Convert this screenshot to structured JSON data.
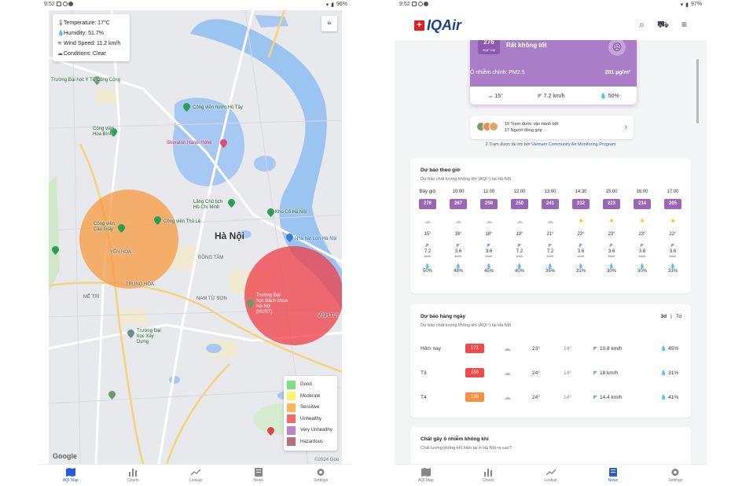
{
  "left": {
    "status": {
      "time": "9:52",
      "battery": "96%"
    },
    "weather": {
      "temperature": "Temperature: 17°C",
      "humidity": "Humidity: 51.7%",
      "wind": "Wind Speed: 11.2 km/h",
      "conditions": "Conditions: Clear"
    },
    "map": {
      "city": "Hà Nội",
      "places": [
        {
          "name": "Trường Đại học Y Tế Công Cộng",
          "style": "green"
        },
        {
          "name": "Công viên nước Hồ Tây",
          "style": "green"
        },
        {
          "name": "Công viên Hòa Bình",
          "style": "green"
        },
        {
          "name": "Sheraton Hanoi Hotel",
          "style": "pink"
        },
        {
          "name": "Lăng Chủ tịch Hồ Chí Minh",
          "style": "green"
        },
        {
          "name": "Công viên Cầu Giấy",
          "style": "green"
        },
        {
          "name": "Công viên Thủ Lệ",
          "style": "green"
        },
        {
          "name": "Khu Cổ Hà Nội",
          "style": "green"
        },
        {
          "name": "Nhà hát Lớn Hà Nội",
          "style": "blue"
        },
        {
          "name": "YÊN HÒA",
          "style": "dark"
        },
        {
          "name": "TRUNG HÒA",
          "style": "dark"
        },
        {
          "name": "Trường Đại học Bách khoa Hà Nội (HUST)",
          "style": "green"
        },
        {
          "name": "Trường Đại học Xây Dựng",
          "style": "green"
        },
        {
          "name": "ĐỒNG TÂM",
          "style": "dark"
        },
        {
          "name": "MỄ TRÌ",
          "style": "dark"
        },
        {
          "name": "NAM TỪ SƠN",
          "style": "dark"
        },
        {
          "name": "VĨNH TUY",
          "style": "dark"
        }
      ],
      "copyright": "©2024 Goo",
      "google": "Google"
    },
    "legend": [
      {
        "label": "Good",
        "color": "#7ee07e"
      },
      {
        "label": "Moderate",
        "color": "#fff36b"
      },
      {
        "label": "Sensitive",
        "color": "#ffb45a"
      },
      {
        "label": "Unhealthy",
        "color": "#f26a6a"
      },
      {
        "label": "Very Unhealthy",
        "color": "#b984c9"
      },
      {
        "label": "Hazardous",
        "color": "#b8707c"
      }
    ],
    "nav": [
      {
        "label": "AQI Map",
        "icon": "map-icon",
        "active": true
      },
      {
        "label": "Charts",
        "icon": "bar-chart-icon",
        "active": false
      },
      {
        "label": "Lookup",
        "icon": "trend-icon",
        "active": false
      },
      {
        "label": "News",
        "icon": "news-icon",
        "active": false
      },
      {
        "label": "Settings",
        "icon": "gear-icon",
        "active": false
      }
    ]
  },
  "right": {
    "status": {
      "time": "9:52",
      "battery": "97%"
    },
    "brand": "IQAir",
    "aqi": {
      "value": "276",
      "unit": "AQI⁺ Mỹ",
      "status": "Rất không tốt",
      "main_pollutant": "Ô nhiễm chính: PM2.5",
      "concentration": "201 µg/m³",
      "temp": "15°",
      "wind": "7.2 km/h",
      "humidity": "50%"
    },
    "stations": {
      "line1": "19 Trạm được vận hành bởi",
      "line2": "17 Người đóng góp"
    },
    "sponsor": {
      "text": "2 Trạm được tài trợ bởi",
      "link": "Vietnam Community Air Monitoring Program"
    },
    "hourly": {
      "title": "Dự báo theo giờ",
      "subtitle": "Dự báo chất lượng không khí (AQI⁺) tại Hà Nội",
      "hours": [
        {
          "time": "Bây giờ",
          "aqi": "276",
          "weather": "cloud",
          "temp": "15°",
          "wind": "7.2",
          "hum": "50%"
        },
        {
          "time": "10:00",
          "aqi": "267",
          "weather": "cloud",
          "temp": "16°",
          "wind": "3.6",
          "hum": "48%"
        },
        {
          "time": "11:00",
          "aqi": "258",
          "weather": "cloud",
          "temp": "18°",
          "wind": "3.6",
          "hum": "45%"
        },
        {
          "time": "12:00",
          "aqi": "250",
          "weather": "cloud",
          "temp": "19°",
          "wind": "7.2",
          "hum": "40%"
        },
        {
          "time": "13:00",
          "aqi": "241",
          "weather": "cloud",
          "temp": "21°",
          "wind": "7.2",
          "hum": "35%"
        },
        {
          "time": "14:30",
          "aqi": "232",
          "weather": "sun",
          "temp": "23°",
          "wind": "3.6",
          "hum": "31%"
        },
        {
          "time": "15:00",
          "aqi": "223",
          "weather": "sun",
          "temp": "23°",
          "wind": "3.6",
          "hum": "30%"
        },
        {
          "time": "16:00",
          "aqi": "214",
          "weather": "sun",
          "temp": "23°",
          "wind": "3.6",
          "hum": "30%"
        },
        {
          "time": "17:00",
          "aqi": "205",
          "weather": "sun",
          "temp": "22°",
          "wind": "3.6",
          "hum": "33%"
        }
      ],
      "wind_unit": "km/h"
    },
    "daily": {
      "title": "Dự báo hàng ngày",
      "subtitle": "Dự báo chất lượng không khí (AQI⁺) tại Hà Nội",
      "toggle_3d": "3d",
      "toggle_7d": "7d",
      "days": [
        {
          "day": "Hôm nay",
          "aqi": "171",
          "color": "#ef4b4b",
          "hi": "23°",
          "lo": "14°",
          "wind": "10.8 km/h",
          "hum": "45%"
        },
        {
          "day": "T3",
          "aqi": "155",
          "color": "#ef4b4b",
          "hi": "24°",
          "lo": "14°",
          "wind": "18 km/h",
          "hum": "31%"
        },
        {
          "day": "T4",
          "aqi": "135",
          "color": "#f5913f",
          "hi": "24°",
          "lo": "14°",
          "wind": "14.4 km/h",
          "hum": "41%"
        }
      ]
    },
    "pollutants": {
      "title": "Chất gây ô nhiễm không khí",
      "subtitle": "Chất lượng không khí hiện tại ở Hà Nội ra sao?"
    },
    "nav": [
      {
        "label": "AQI Map",
        "icon": "map-icon",
        "active": false
      },
      {
        "label": "Charts",
        "icon": "bar-chart-icon",
        "active": false
      },
      {
        "label": "Lookup",
        "icon": "trend-icon",
        "active": false
      },
      {
        "label": "News",
        "icon": "news-icon",
        "active": true
      },
      {
        "label": "Settings",
        "icon": "gear-icon",
        "active": false
      }
    ]
  }
}
